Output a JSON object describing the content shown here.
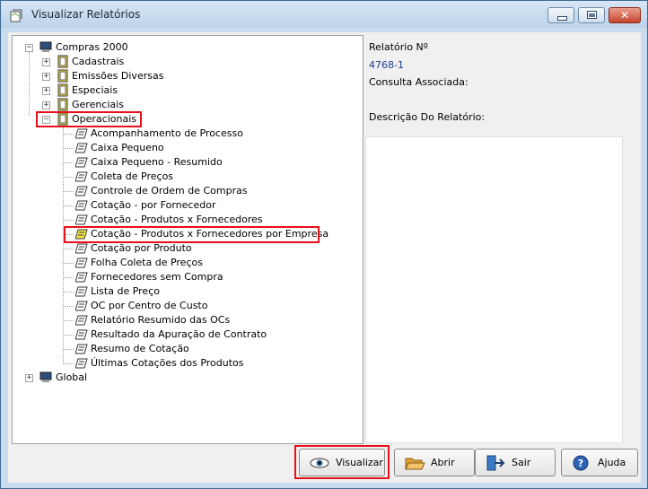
{
  "window": {
    "title": "Visualizar Relatórios"
  },
  "tree": {
    "root1": {
      "label": "Compras 2000",
      "expander": "−"
    },
    "groups": [
      {
        "label": "Cadastrais",
        "expander": "+"
      },
      {
        "label": "Emissões Diversas",
        "expander": "+"
      },
      {
        "label": "Especiais",
        "expander": "+"
      },
      {
        "label": "Gerenciais",
        "expander": "+"
      },
      {
        "label": "Operacionais",
        "expander": "−"
      }
    ],
    "reports": [
      "Acompanhamento de Processo",
      "Caixa Pequeno",
      "Caixa Pequeno - Resumido",
      "Coleta de Preços",
      "Controle de Ordem de Compras",
      "Cotação - por Fornecedor",
      "Cotação - Produtos x Fornecedores",
      "Cotação - Produtos x Fornecedores por Empresa",
      "Cotação por Produto",
      "Folha Coleta de Preços",
      "Fornecedores sem Compra",
      "Lista de Preço",
      "OC por Centro de Custo",
      "Relatório Resumido das OCs",
      "Resultado da Apuração de Contrato",
      "Resumo de Cotação",
      "Últimas Cotações dos Produtos"
    ],
    "selected_report": "Cotação - Produtos x Fornecedores por Empresa",
    "root2": {
      "label": "Global",
      "expander": "+"
    }
  },
  "details": {
    "report_no_label": "Relatório Nº",
    "report_no_value": "4768-1",
    "query_label": "Consulta Associada:",
    "description_label": "Descrição Do Relatório:"
  },
  "buttons": {
    "view": "Visualizar",
    "open": "Abrir",
    "exit": "Sair",
    "help": "Ajuda"
  },
  "colors": {
    "highlight": "#e8101a",
    "value_text": "#1f3d8a"
  }
}
